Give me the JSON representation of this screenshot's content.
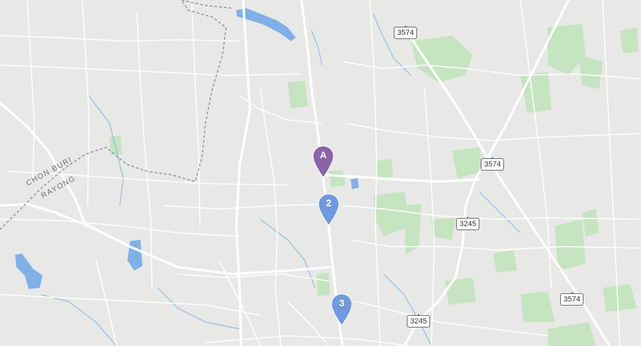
{
  "map": {
    "boundary_labels": {
      "upper": "CHON BURI",
      "lower": "RAYONG"
    },
    "route_shields": [
      "3574",
      "3574",
      "3245",
      "3245",
      "3574"
    ],
    "markers": [
      {
        "label": "A",
        "color": "#8a63a8"
      },
      {
        "label": "2",
        "color": "#6f9ae0"
      },
      {
        "label": "3",
        "color": "#6f9ae0"
      }
    ],
    "colors": {
      "land": "#e8e8e6",
      "road": "#ffffff",
      "water": "#7fb0e8",
      "park": "#c5e4c0",
      "boundary": "#8c8c8c"
    }
  }
}
